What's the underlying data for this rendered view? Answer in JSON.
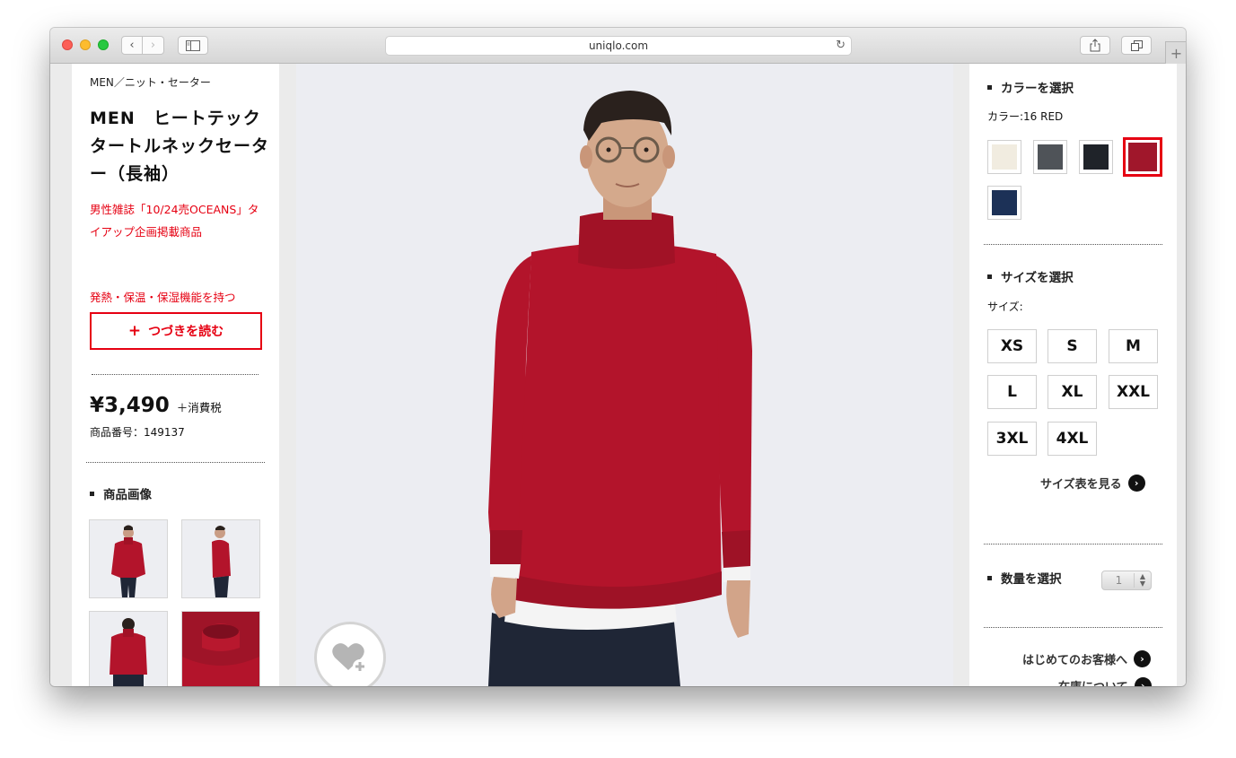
{
  "browser": {
    "url": "uniqlo.com",
    "nav": {
      "back": "‹",
      "forward": "›"
    }
  },
  "product": {
    "breadcrumb": "MEN／ニット・セーター",
    "title": "MEN　ヒートテックタートルネックセーター（長袖）",
    "promo": "男性雑誌「10/24売OCEANS」タイアップ企画掲載商品",
    "feature": "発熱・保温・保湿機能を持つ",
    "read_more": "つづきを読む",
    "read_more_icon": "+",
    "price": "¥3,490",
    "tax_note": "＋消費税",
    "product_number": "商品番号：149137",
    "images_title": "商品画像"
  },
  "options": {
    "color_title": "カラーを選択",
    "color_label": "カラー:16 RED",
    "colors": [
      {
        "name": "off-white",
        "hex": "#f1ece0",
        "selected": false
      },
      {
        "name": "gray",
        "hex": "#4f5358",
        "selected": false
      },
      {
        "name": "black",
        "hex": "#1f2329",
        "selected": false
      },
      {
        "name": "red",
        "hex": "#a0172b",
        "selected": true
      },
      {
        "name": "navy",
        "hex": "#1c3157",
        "selected": false
      }
    ],
    "size_title": "サイズを選択",
    "size_label": "サイズ:",
    "sizes": [
      "XS",
      "S",
      "M",
      "L",
      "XL",
      "XXL",
      "3XL",
      "4XL"
    ],
    "size_chart_link": "サイズ表を見る",
    "quantity_title": "数量を選択",
    "quantity_value": "1",
    "first_time_link": "はじめてのお客様へ",
    "store_link": "在庫について"
  },
  "colors": {
    "accent_red": "#e60012",
    "sweater_red": "#b3142b"
  }
}
